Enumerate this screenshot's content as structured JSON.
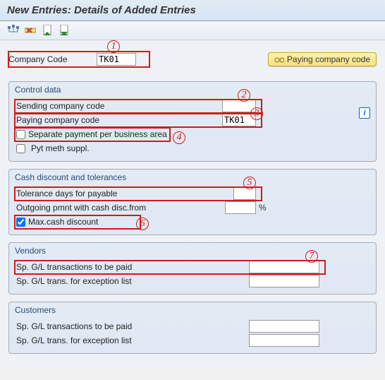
{
  "title": "New Entries: Details of Added Entries",
  "toolbar": {
    "icons": [
      "structure-icon",
      "delete-row-icon",
      "prev-page-icon",
      "next-page-icon"
    ]
  },
  "company_code": {
    "label": "Company Code",
    "value": "TK01"
  },
  "paying_cc_btn": {
    "label": "Paying company code"
  },
  "groups": {
    "control": {
      "title": "Control data",
      "sending_label": "Sending company code",
      "sending_value": "",
      "paying_label": "Paying company code",
      "paying_value": "TK01",
      "sep_payment_label": "Separate payment per business area",
      "sep_payment_checked": false,
      "pyt_suppl_label": "Pyt meth suppl.",
      "pyt_suppl_checked": false
    },
    "discount": {
      "title": "Cash discount and tolerances",
      "tol_days_label": "Tolerance days for payable",
      "tol_days_value": "",
      "outgoing_label": "Outgoing pmnt with cash disc.from",
      "outgoing_value": "",
      "outgoing_unit": "%",
      "max_disc_label": "Max.cash discount",
      "max_disc_checked": true
    },
    "vendors": {
      "title": "Vendors",
      "paid_label": "Sp. G/L transactions to be paid",
      "paid_value": "",
      "exc_label": "Sp. G/L trans. for exception list",
      "exc_value": ""
    },
    "customers": {
      "title": "Customers",
      "paid_label": "Sp. G/L transactions to be paid",
      "paid_value": "",
      "exc_label": "Sp. G/L trans. for exception list",
      "exc_value": ""
    }
  },
  "annotations": [
    "1",
    "2",
    "3",
    "4",
    "5",
    "6",
    "7"
  ]
}
